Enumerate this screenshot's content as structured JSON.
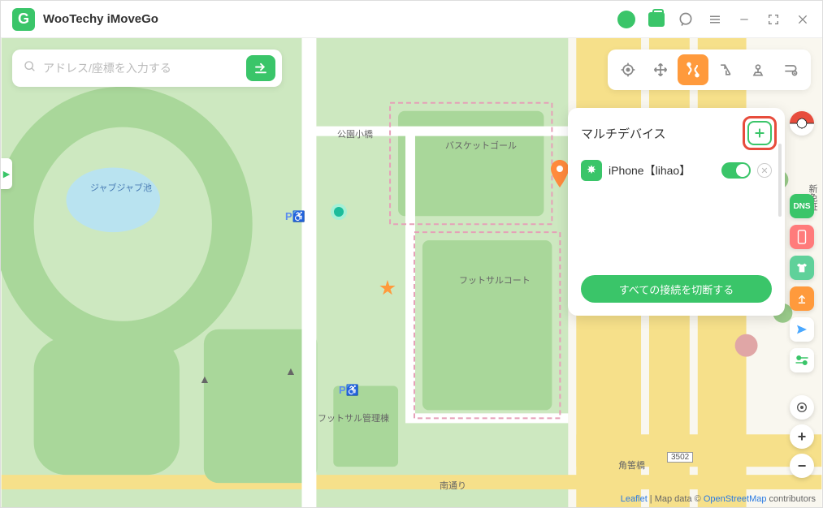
{
  "app": {
    "title": "WooTechy iMoveGo",
    "logo_letter": "G"
  },
  "search": {
    "placeholder": "アドレス/座標を入力する"
  },
  "device_panel": {
    "title": "マルチデバイス",
    "devices": [
      {
        "name": "iPhone【lihao】",
        "enabled": true
      }
    ],
    "disconnect_label": "すべての接続を切断する"
  },
  "map_labels": {
    "pond": "ジャブジャブ池",
    "bridge": "公園小橋",
    "basketball": "バスケットゴール",
    "futsal_court": "フットサルコート",
    "futsal_admin": "フットサル管理棟",
    "south_street": "南通り",
    "corner_bridge": "角筈橋",
    "road_num": "3502",
    "side_char": "新免証",
    "side_street": "園通り"
  },
  "attribution": {
    "leaflet": "Leaflet",
    "sep": " | Map data © ",
    "osm": "OpenStreetMap",
    "tail": " contributors"
  },
  "icons": {
    "dns": "DNS"
  }
}
